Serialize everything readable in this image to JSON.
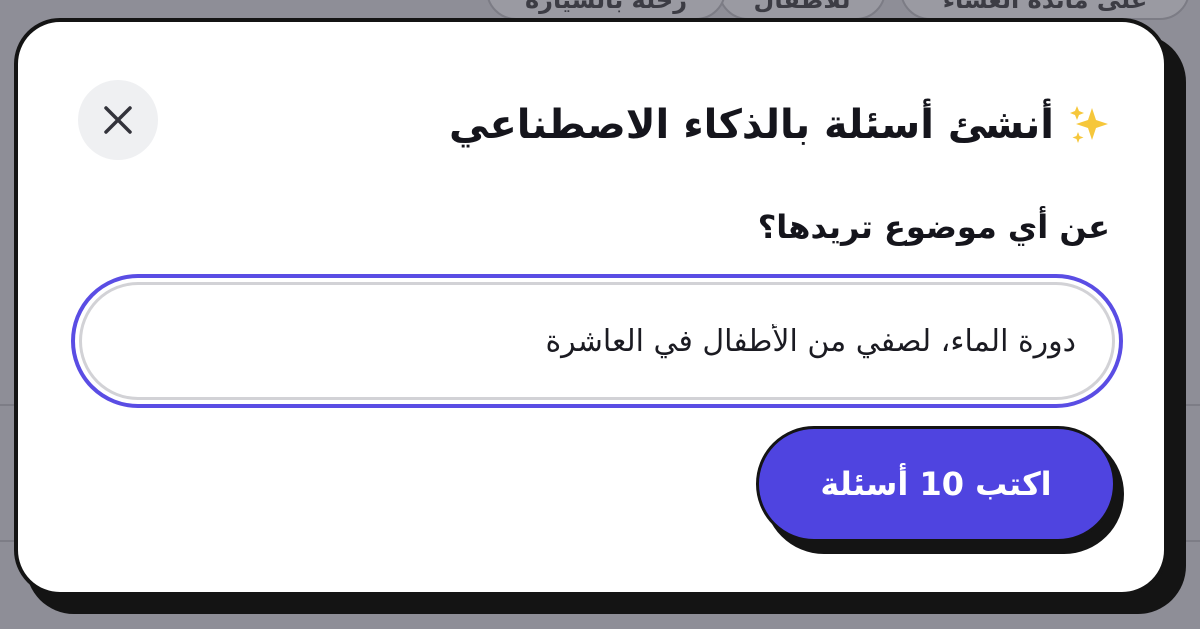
{
  "background": {
    "pills": [
      "على مائدة العشاء",
      "للأطفال",
      "رحلة بالسيارة"
    ]
  },
  "modal": {
    "title": "أنشئ أسئلة بالذكاء الاصطناعي",
    "title_icon": "sparkles-icon",
    "close_icon": "close-icon",
    "field_label": "عن أي موضوع تريدها؟",
    "topic_value": "دورة الماء، لصفي من الأطفال في العاشرة",
    "submit_label": "اكتب 10 أسئلة"
  },
  "colors": {
    "accent": "#4f44e0",
    "focus_ring": "#5a4de4",
    "sparkle": "#f6c73b",
    "text": "#15151c"
  }
}
